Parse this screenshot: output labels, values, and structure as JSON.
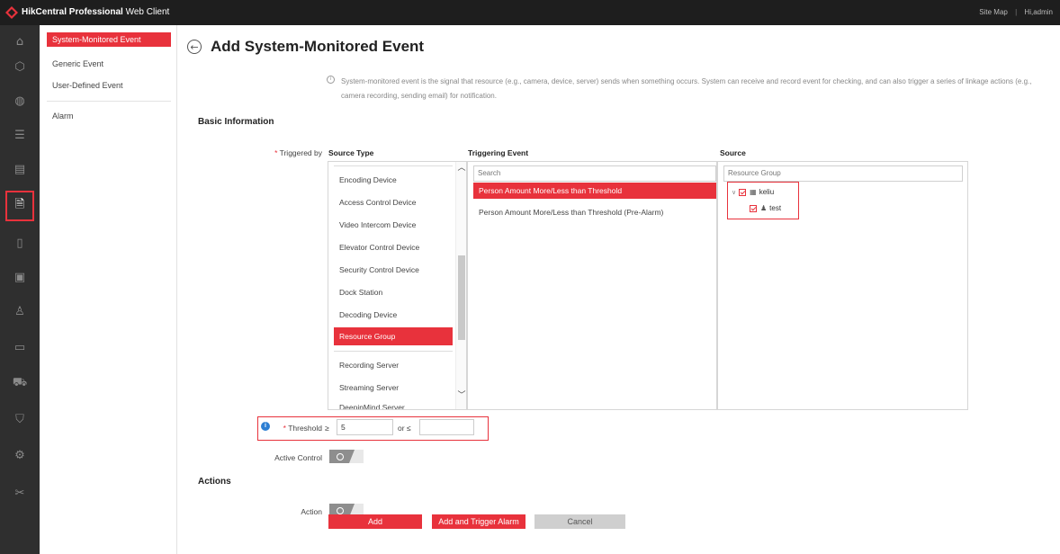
{
  "app": {
    "title_bold": "HikCentral Professional",
    "title_light": " Web Client",
    "site_map": "Site Map",
    "separator": "|",
    "user": "Hi,admin"
  },
  "rail_icons": [
    "home-icon",
    "resource-icon",
    "globe-icon",
    "server-icon",
    "building-icon",
    "event-config-icon",
    "log-icon",
    "calendar-icon",
    "person-icon",
    "card-icon",
    "vehicle-icon",
    "shield-icon",
    "settings-icon",
    "tools-icon"
  ],
  "submenu": {
    "items": [
      {
        "label": "System-Monitored Event"
      },
      {
        "label": "Generic Event"
      },
      {
        "label": "User-Defined Event"
      },
      {
        "label": "Alarm"
      }
    ]
  },
  "page": {
    "title": "Add System-Monitored Event",
    "info": "System-monitored event is the signal that resource (e.g., camera, device, server) sends when something occurs. System can receive and record event for checking, and can also trigger a series of linkage actions (e.g., camera recording, sending email) for notification."
  },
  "basic": {
    "section": "Basic Information",
    "triggered_by": "Triggered by",
    "source_type_head": "Source Type",
    "triggering_event_head": "Triggering Event",
    "source_head": "Source",
    "source_types": [
      "Encoding Device",
      "Access Control Device",
      "Video Intercom Device",
      "Elevator Control Device",
      "Security Control Device",
      "Dock Station",
      "Decoding Device",
      "Resource Group",
      "Recording Server",
      "Streaming Server",
      "DeepinMind Server"
    ],
    "event_search_placeholder": "Search",
    "events": [
      "Person Amount More/Less than Threshold",
      "Person Amount More/Less than Threshold (Pre-Alarm)"
    ],
    "source_search_placeholder": "Resource Group",
    "tree": {
      "root": "keliu",
      "child": "test"
    }
  },
  "threshold": {
    "label": "Threshold",
    "ge": "≥",
    "min_value": "5",
    "or_le": "or ≤",
    "max_value": ""
  },
  "active_control": {
    "label": "Active Control"
  },
  "actions": {
    "section": "Actions",
    "action_label": "Action"
  },
  "buttons": {
    "add": "Add",
    "add_trigger": "Add and Trigger Alarm",
    "cancel": "Cancel"
  },
  "colors": {
    "accent": "#e8323c",
    "topbar": "#1e1e1e",
    "rail": "#2f2f2f"
  }
}
